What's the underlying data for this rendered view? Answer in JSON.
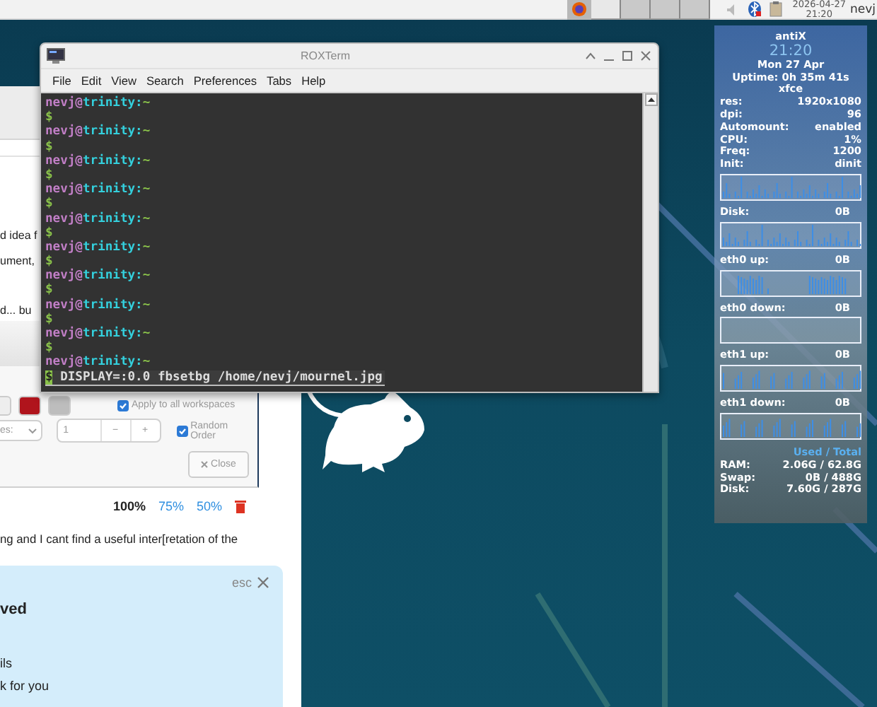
{
  "top_panel": {
    "date": "2026-04-27",
    "time": "21:20",
    "user": "nevj"
  },
  "browser": {
    "lines": [
      "d idea f",
      "ument,",
      "d... bu"
    ],
    "dialog": {
      "swatches": [
        {
          "color": "#eeeeee"
        },
        {
          "color": "#b0141c"
        },
        {
          "color": "#bdbdbd"
        }
      ],
      "apply_all": {
        "label": "Apply to all workspaces",
        "checked": true
      },
      "dropdown_label": "es:",
      "spin_value": "1",
      "spin_minus": "−",
      "spin_plus": "+",
      "random_order": {
        "label": "Random Order",
        "checked": true
      },
      "close_label": "Close"
    },
    "zoom_options": [
      {
        "label": "100%",
        "selected": true
      },
      {
        "label": "75%",
        "selected": false
      },
      {
        "label": "50%",
        "selected": false
      }
    ],
    "post_text": "ng and I cant find a useful inter[retation of the",
    "notice": {
      "dismiss_label": "esc",
      "heading": "ved",
      "lines": [
        "ils",
        "k for you"
      ]
    }
  },
  "terminal": {
    "title": "ROXTerm",
    "menus": [
      "File",
      "Edit",
      "View",
      "Search",
      "Preferences",
      "Tabs",
      "Help"
    ],
    "lines": [
      {
        "kind": "prompt",
        "user": "nevj@",
        "host": "trinity:",
        "path": "~"
      },
      {
        "kind": "input",
        "sign": "$"
      },
      {
        "kind": "prompt",
        "user": "nevj@",
        "host": "trinity:",
        "path": "~"
      },
      {
        "kind": "input",
        "sign": "$"
      },
      {
        "kind": "prompt",
        "user": "nevj@",
        "host": "trinity:",
        "path": "~"
      },
      {
        "kind": "input",
        "sign": "$"
      },
      {
        "kind": "prompt",
        "user": "nevj@",
        "host": "trinity:",
        "path": "~"
      },
      {
        "kind": "input",
        "sign": "$"
      },
      {
        "kind": "prompt",
        "user": "nevj@",
        "host": "trinity:",
        "path": "~"
      },
      {
        "kind": "input",
        "sign": "$"
      },
      {
        "kind": "prompt",
        "user": "nevj@",
        "host": "trinity:",
        "path": "~"
      },
      {
        "kind": "input",
        "sign": "$"
      },
      {
        "kind": "prompt",
        "user": "nevj@",
        "host": "trinity:",
        "path": "~"
      },
      {
        "kind": "input",
        "sign": "$"
      },
      {
        "kind": "prompt",
        "user": "nevj@",
        "host": "trinity:",
        "path": "~"
      },
      {
        "kind": "input",
        "sign": "$"
      },
      {
        "kind": "prompt",
        "user": "nevj@",
        "host": "trinity:",
        "path": "~"
      },
      {
        "kind": "input",
        "sign": "$"
      },
      {
        "kind": "prompt",
        "user": "nevj@",
        "host": "trinity:",
        "path": "~"
      },
      {
        "kind": "input",
        "sign": "$",
        "command": "DISPLAY=:0.0 fbsetbg /home/nevj/mournel.jpg"
      }
    ]
  },
  "conky": {
    "name": "antiX",
    "time": "21:20",
    "date": "Mon 27 Apr",
    "uptime": "Uptime: 0h 35m 41s",
    "desktop": "xfce",
    "stats": [
      {
        "label": "res:",
        "value": "1920x1080"
      },
      {
        "label": "dpi:",
        "value": "96"
      },
      {
        "label": "Automount:",
        "value": "enabled"
      },
      {
        "label": "CPU:",
        "value": "1%"
      },
      {
        "label": "Freq:",
        "value": "1200"
      },
      {
        "label": "Init:",
        "value": "dinit"
      }
    ],
    "graphs": [
      {
        "label": "Disk:",
        "value": "0B"
      },
      {
        "label": "eth0 up:",
        "value": "0B"
      },
      {
        "label": "eth0 down:",
        "value": "0B"
      },
      {
        "label": "eth1 up:",
        "value": "0B"
      },
      {
        "label": "eth1 down:",
        "value": "0B"
      }
    ],
    "memory_header": "Used / Total",
    "memory": [
      {
        "label": "RAM:",
        "value": "2.06G / 62.8G"
      },
      {
        "label": "Swap:",
        "value": "0B / 488G"
      },
      {
        "label": "Disk:",
        "value": "7.60G / 287G"
      }
    ]
  }
}
